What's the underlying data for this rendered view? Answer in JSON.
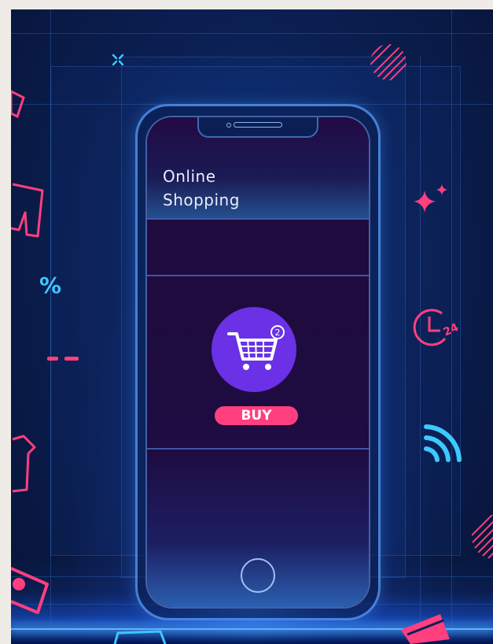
{
  "screen": {
    "title_line1": "Online",
    "title_line2": "Shopping",
    "cart_badge": "2",
    "buy_label": "BUY"
  },
  "decorations": {
    "percent_symbol": "%"
  },
  "icons": [
    "shopping-cart-icon",
    "shirt-icon",
    "percent-icon",
    "clock-24-icon",
    "wifi-icon",
    "sparkle-icon",
    "credit-card-icon"
  ],
  "colors": {
    "background": "#0b1f52",
    "accent_pink": "#ff3f7e",
    "accent_cyan": "#3dc8ff",
    "cart_purple": "#6a31e6",
    "screen_dark": "#1f0b3d"
  }
}
